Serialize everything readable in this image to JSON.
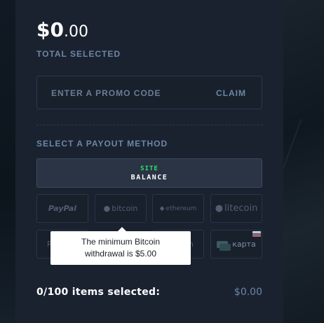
{
  "summary": {
    "amount_main": "$0",
    "amount_cents": ".00",
    "total_label": "TOTAL SELECTED"
  },
  "promo": {
    "placeholder": "ENTER A PROMO CODE",
    "claim_label": "CLAIM"
  },
  "payout": {
    "label": "SELECT A PAYOUT METHOD",
    "site_balance_top": "SITE",
    "site_balance_bottom": "BALANCE",
    "methods": [
      {
        "name": "PayPal"
      },
      {
        "name": "bitcoin"
      },
      {
        "name": "ethereum"
      },
      {
        "name": "litecoin"
      },
      {
        "name": "P"
      },
      {
        "name": "ch"
      },
      {
        "name": "карта"
      }
    ]
  },
  "tooltip": {
    "line1": "The minimum Bitcoin",
    "line2": "withdrawal is $5.00"
  },
  "footer": {
    "items_selected": "0/100 items selected:",
    "selected_total": "$0.00"
  },
  "colors": {
    "panel_bg": "#1a2230",
    "accent_label": "#6e86a4",
    "site_green": "#2ee06a"
  }
}
